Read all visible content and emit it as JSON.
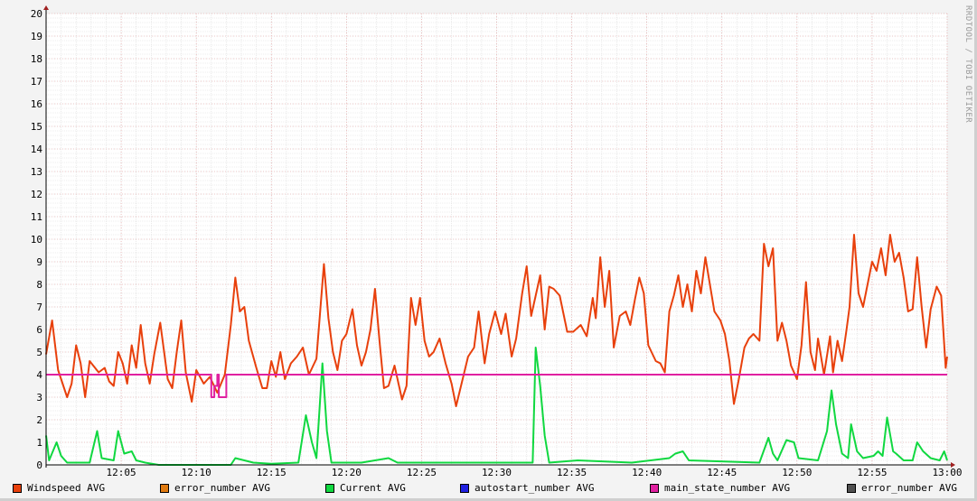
{
  "credit": "RRDTOOL / TOBI OETIKER",
  "chart_data": {
    "type": "line",
    "title": "",
    "xlabel": "",
    "ylabel": "",
    "ylim": [
      0,
      20
    ],
    "xlim_minutes_after_12_00": [
      0,
      60
    ],
    "y_ticks": [
      "0",
      "1",
      "2",
      "3",
      "4",
      "5",
      "6",
      "7",
      "8",
      "9",
      "10",
      "11",
      "12",
      "13",
      "14",
      "15",
      "16",
      "17",
      "18",
      "19",
      "20"
    ],
    "x_ticks": [
      {
        "t": 5,
        "label": "12:05"
      },
      {
        "t": 10,
        "label": "12:10"
      },
      {
        "t": 15,
        "label": "12:15"
      },
      {
        "t": 20,
        "label": "12:20"
      },
      {
        "t": 25,
        "label": "12:25"
      },
      {
        "t": 30,
        "label": "12:30"
      },
      {
        "t": 35,
        "label": "12:35"
      },
      {
        "t": 40,
        "label": "12:40"
      },
      {
        "t": 45,
        "label": "12:45"
      },
      {
        "t": 50,
        "label": "12:50"
      },
      {
        "t": 55,
        "label": "12:55"
      },
      {
        "t": 60,
        "label": "13:00"
      }
    ],
    "grid": true,
    "legend_position": "bottom",
    "legend": [
      {
        "label": "Windspeed AVG",
        "color": "#e8400c"
      },
      {
        "label": "error_number AVG",
        "color": "#e07a10"
      },
      {
        "label": "Current AVG",
        "color": "#10d840"
      },
      {
        "label": "autostart_number AVG",
        "color": "#2020e0"
      },
      {
        "label": "main_state_number AVG",
        "color": "#e020a0"
      },
      {
        "label": "error_number AVG",
        "color": "#505050"
      }
    ],
    "series": [
      {
        "name": "Windspeed AVG",
        "color": "#e8400c",
        "points": [
          [
            0,
            4.9
          ],
          [
            0.4,
            6.4
          ],
          [
            0.8,
            4.2
          ],
          [
            1.4,
            3.0
          ],
          [
            1.7,
            3.6
          ],
          [
            2.0,
            5.3
          ],
          [
            2.3,
            4.5
          ],
          [
            2.6,
            3.0
          ],
          [
            2.9,
            4.6
          ],
          [
            3.5,
            4.1
          ],
          [
            3.9,
            4.3
          ],
          [
            4.2,
            3.7
          ],
          [
            4.5,
            3.5
          ],
          [
            4.8,
            5.0
          ],
          [
            5.1,
            4.5
          ],
          [
            5.4,
            3.6
          ],
          [
            5.7,
            5.3
          ],
          [
            6.0,
            4.3
          ],
          [
            6.3,
            6.2
          ],
          [
            6.6,
            4.5
          ],
          [
            6.9,
            3.6
          ],
          [
            7.2,
            4.9
          ],
          [
            7.6,
            6.3
          ],
          [
            8.1,
            3.8
          ],
          [
            8.4,
            3.4
          ],
          [
            8.7,
            5.0
          ],
          [
            9.0,
            6.4
          ],
          [
            9.3,
            4.1
          ],
          [
            9.7,
            2.8
          ],
          [
            10.0,
            4.2
          ],
          [
            10.5,
            3.6
          ],
          [
            10.9,
            3.9
          ],
          [
            11.4,
            3.2
          ],
          [
            11.9,
            4.0
          ],
          [
            12.3,
            6.2
          ],
          [
            12.6,
            8.3
          ],
          [
            12.9,
            6.8
          ],
          [
            13.2,
            7.0
          ],
          [
            13.5,
            5.5
          ],
          [
            14.0,
            4.3
          ],
          [
            14.4,
            3.4
          ],
          [
            14.7,
            3.4
          ],
          [
            15.0,
            4.6
          ],
          [
            15.3,
            3.9
          ],
          [
            15.6,
            5.0
          ],
          [
            15.9,
            3.8
          ],
          [
            16.3,
            4.5
          ],
          [
            16.7,
            4.8
          ],
          [
            17.1,
            5.2
          ],
          [
            17.5,
            4.0
          ],
          [
            18.0,
            4.7
          ],
          [
            18.5,
            8.9
          ],
          [
            18.8,
            6.5
          ],
          [
            19.1,
            5.0
          ],
          [
            19.4,
            4.2
          ],
          [
            19.7,
            5.5
          ],
          [
            20.0,
            5.8
          ],
          [
            20.4,
            6.9
          ],
          [
            20.7,
            5.3
          ],
          [
            21.0,
            4.4
          ],
          [
            21.3,
            5.0
          ],
          [
            21.6,
            6.0
          ],
          [
            21.9,
            7.8
          ],
          [
            22.2,
            5.5
          ],
          [
            22.5,
            3.4
          ],
          [
            22.8,
            3.5
          ],
          [
            23.2,
            4.4
          ],
          [
            23.7,
            2.9
          ],
          [
            24.0,
            3.5
          ],
          [
            24.3,
            7.4
          ],
          [
            24.6,
            6.2
          ],
          [
            24.9,
            7.4
          ],
          [
            25.2,
            5.5
          ],
          [
            25.5,
            4.8
          ],
          [
            25.8,
            5.0
          ],
          [
            26.2,
            5.6
          ],
          [
            26.6,
            4.5
          ],
          [
            27.0,
            3.6
          ],
          [
            27.3,
            2.6
          ],
          [
            27.7,
            3.7
          ],
          [
            28.1,
            4.8
          ],
          [
            28.5,
            5.2
          ],
          [
            28.8,
            6.8
          ],
          [
            29.2,
            4.5
          ],
          [
            29.5,
            5.8
          ],
          [
            29.9,
            6.8
          ],
          [
            30.3,
            5.8
          ],
          [
            30.6,
            6.7
          ],
          [
            31.0,
            4.8
          ],
          [
            31.3,
            5.6
          ],
          [
            31.7,
            7.6
          ],
          [
            32.0,
            8.8
          ],
          [
            32.3,
            6.6
          ],
          [
            32.6,
            7.5
          ],
          [
            32.9,
            8.4
          ],
          [
            33.2,
            6.0
          ],
          [
            33.5,
            7.9
          ],
          [
            33.8,
            7.8
          ],
          [
            34.2,
            7.5
          ],
          [
            34.7,
            5.9
          ],
          [
            35.1,
            5.9
          ],
          [
            35.6,
            6.2
          ],
          [
            36.0,
            5.7
          ],
          [
            36.4,
            7.4
          ],
          [
            36.6,
            6.5
          ],
          [
            36.9,
            9.2
          ],
          [
            37.2,
            7.0
          ],
          [
            37.5,
            8.6
          ],
          [
            37.8,
            5.2
          ],
          [
            38.2,
            6.6
          ],
          [
            38.6,
            6.8
          ],
          [
            38.9,
            6.2
          ],
          [
            39.2,
            7.3
          ],
          [
            39.5,
            8.3
          ],
          [
            39.8,
            7.6
          ],
          [
            40.1,
            5.3
          ],
          [
            40.6,
            4.6
          ],
          [
            40.9,
            4.5
          ],
          [
            41.2,
            4.1
          ],
          [
            41.5,
            6.8
          ],
          [
            41.8,
            7.5
          ],
          [
            42.1,
            8.4
          ],
          [
            42.4,
            7.0
          ],
          [
            42.7,
            8.0
          ],
          [
            43.0,
            6.8
          ],
          [
            43.3,
            8.6
          ],
          [
            43.6,
            7.6
          ],
          [
            43.9,
            9.2
          ],
          [
            44.2,
            8.0
          ],
          [
            44.5,
            6.8
          ],
          [
            44.9,
            6.4
          ],
          [
            45.2,
            5.8
          ],
          [
            45.5,
            4.6
          ],
          [
            45.8,
            2.7
          ],
          [
            46.1,
            3.7
          ],
          [
            46.5,
            5.2
          ],
          [
            46.8,
            5.6
          ],
          [
            47.1,
            5.8
          ],
          [
            47.5,
            5.5
          ],
          [
            47.8,
            9.8
          ],
          [
            48.1,
            8.8
          ],
          [
            48.4,
            9.6
          ],
          [
            48.7,
            5.5
          ],
          [
            49.0,
            6.3
          ],
          [
            49.3,
            5.5
          ],
          [
            49.6,
            4.4
          ],
          [
            50.0,
            3.8
          ],
          [
            50.3,
            5.3
          ],
          [
            50.6,
            8.1
          ],
          [
            50.9,
            5.0
          ],
          [
            51.2,
            4.2
          ],
          [
            51.4,
            5.6
          ],
          [
            51.8,
            4.0
          ],
          [
            52.2,
            5.7
          ],
          [
            52.4,
            4.1
          ],
          [
            52.7,
            5.5
          ],
          [
            53.0,
            4.6
          ],
          [
            53.3,
            6.0
          ],
          [
            53.5,
            7.0
          ],
          [
            53.8,
            10.2
          ],
          [
            54.1,
            7.6
          ],
          [
            54.4,
            7.0
          ],
          [
            54.7,
            8.0
          ],
          [
            55.0,
            9.0
          ],
          [
            55.3,
            8.6
          ],
          [
            55.6,
            9.6
          ],
          [
            55.9,
            8.4
          ],
          [
            56.2,
            10.2
          ],
          [
            56.5,
            9.0
          ],
          [
            56.8,
            9.4
          ],
          [
            57.1,
            8.3
          ],
          [
            57.4,
            6.8
          ],
          [
            57.7,
            6.9
          ],
          [
            58.0,
            9.2
          ],
          [
            58.3,
            7.0
          ],
          [
            58.6,
            5.2
          ],
          [
            58.9,
            6.9
          ],
          [
            59.3,
            7.9
          ],
          [
            59.6,
            7.5
          ],
          [
            59.9,
            4.3
          ],
          [
            60.0,
            4.8
          ]
        ]
      },
      {
        "name": "Current AVG",
        "color": "#10d840",
        "points": [
          [
            0,
            1.3
          ],
          [
            0.2,
            0.2
          ],
          [
            0.7,
            1.0
          ],
          [
            1.0,
            0.4
          ],
          [
            1.4,
            0.1
          ],
          [
            2.9,
            0.1
          ],
          [
            3.4,
            1.5
          ],
          [
            3.7,
            0.3
          ],
          [
            4.5,
            0.2
          ],
          [
            4.8,
            1.5
          ],
          [
            5.2,
            0.5
          ],
          [
            5.7,
            0.6
          ],
          [
            6.0,
            0.2
          ],
          [
            6.6,
            0.1
          ],
          [
            7.5,
            0.0
          ],
          [
            12.3,
            0.0
          ],
          [
            12.6,
            0.3
          ],
          [
            13.2,
            0.2
          ],
          [
            13.8,
            0.1
          ],
          [
            15.0,
            0.05
          ],
          [
            16.8,
            0.1
          ],
          [
            17.3,
            2.2
          ],
          [
            17.7,
            1.0
          ],
          [
            18.0,
            0.3
          ],
          [
            18.4,
            4.5
          ],
          [
            18.7,
            1.5
          ],
          [
            19.0,
            0.1
          ],
          [
            21.0,
            0.1
          ],
          [
            22.8,
            0.3
          ],
          [
            23.4,
            0.1
          ],
          [
            32.4,
            0.1
          ],
          [
            32.6,
            5.2
          ],
          [
            32.9,
            3.5
          ],
          [
            33.2,
            1.3
          ],
          [
            33.5,
            0.1
          ],
          [
            35.4,
            0.2
          ],
          [
            39.0,
            0.1
          ],
          [
            41.5,
            0.3
          ],
          [
            41.9,
            0.5
          ],
          [
            42.4,
            0.6
          ],
          [
            42.8,
            0.2
          ],
          [
            47.5,
            0.1
          ],
          [
            48.1,
            1.2
          ],
          [
            48.4,
            0.5
          ],
          [
            48.7,
            0.2
          ],
          [
            49.3,
            1.1
          ],
          [
            49.8,
            1.0
          ],
          [
            50.1,
            0.3
          ],
          [
            51.4,
            0.2
          ],
          [
            52.0,
            1.5
          ],
          [
            52.3,
            3.3
          ],
          [
            52.6,
            1.8
          ],
          [
            53.0,
            0.5
          ],
          [
            53.4,
            0.3
          ],
          [
            53.6,
            1.8
          ],
          [
            54.0,
            0.6
          ],
          [
            54.4,
            0.3
          ],
          [
            55.1,
            0.4
          ],
          [
            55.4,
            0.6
          ],
          [
            55.7,
            0.4
          ],
          [
            56.0,
            2.1
          ],
          [
            56.4,
            0.6
          ],
          [
            56.6,
            0.5
          ],
          [
            57.1,
            0.2
          ],
          [
            57.7,
            0.2
          ],
          [
            58.0,
            1.0
          ],
          [
            58.4,
            0.6
          ],
          [
            58.9,
            0.3
          ],
          [
            59.5,
            0.2
          ],
          [
            59.8,
            0.6
          ],
          [
            60.0,
            0.2
          ]
        ]
      },
      {
        "name": "main_state_number AVG",
        "color": "#e020a0",
        "step": true,
        "points": [
          [
            0,
            4
          ],
          [
            11.0,
            3
          ],
          [
            11.2,
            3.5
          ],
          [
            11.4,
            4
          ],
          [
            11.5,
            3
          ],
          [
            12.0,
            4
          ],
          [
            60,
            4
          ]
        ]
      }
    ]
  }
}
